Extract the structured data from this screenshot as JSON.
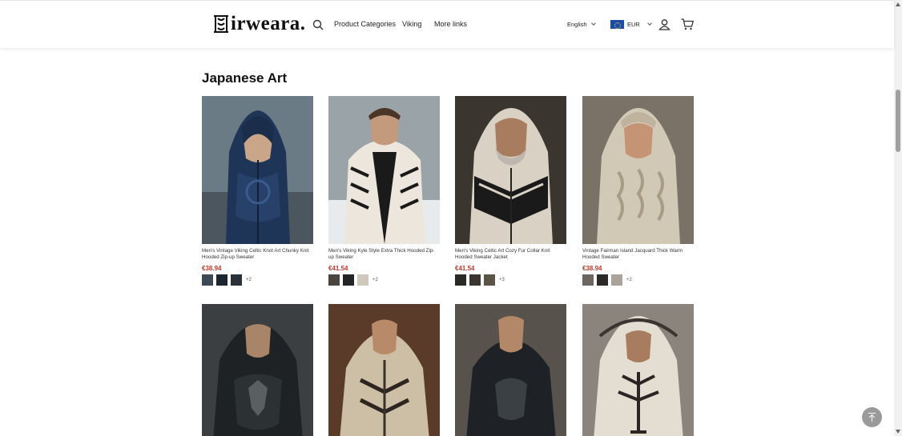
{
  "header": {
    "logo_text": "irweara.",
    "logo_initial": "S",
    "nav": [
      "Product Categories",
      "Viking",
      "More links"
    ],
    "language": "English",
    "currency": "EUR"
  },
  "section": {
    "title": "Japanese Art"
  },
  "products": [
    {
      "name": "Men's Vintage Viking Celtic Knot Art Chunky Knit Hooded Zip-up Sweater",
      "price": "€38.94",
      "more": "+2",
      "swatches": [
        "#3d4a55",
        "#1d2630",
        "#2a3138"
      ]
    },
    {
      "name": "Men's Viking Kyle Style Extra Thick Hooded Zip-up Sweater",
      "price": "€41.54",
      "more": "+2",
      "swatches": [
        "#4a4540",
        "#242424",
        "#cfc8bd"
      ]
    },
    {
      "name": "Men's Viking Celtic Art Cozy Fur Collar Knit Hooded Sweater Jacket",
      "price": "€41.54",
      "more": "+3",
      "swatches": [
        "#2a2926",
        "#3a352e",
        "#5a5346"
      ]
    },
    {
      "name": "Vintage Fairman Island Jacquard Thick Warm Hooded Sweater",
      "price": "€38.94",
      "more": "+2",
      "swatches": [
        "#6a6560",
        "#2b2a28",
        "#a9a39a"
      ]
    }
  ],
  "second_row_products": 4,
  "colors": {
    "price": "#c0392b",
    "flag": "#1a4ca8"
  },
  "icons": [
    "search-icon",
    "user-icon",
    "cart-icon",
    "back-to-top-icon"
  ]
}
